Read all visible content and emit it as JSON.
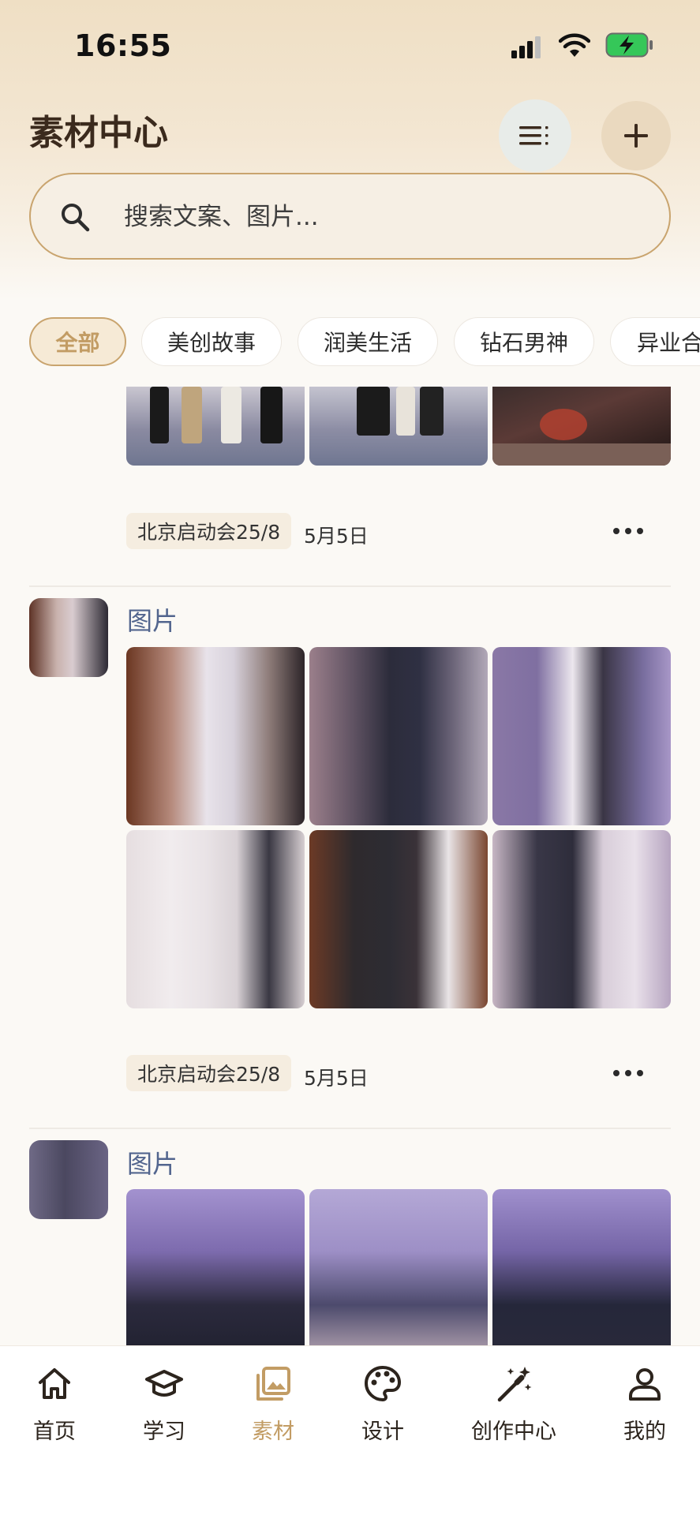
{
  "status_bar": {
    "time": "16:55"
  },
  "header": {
    "title": "素材中心",
    "search_placeholder": "搜索文案、图片..."
  },
  "chips": [
    {
      "label": "全部",
      "active": true
    },
    {
      "label": "美创故事",
      "active": false
    },
    {
      "label": "润美生活",
      "active": false
    },
    {
      "label": "钻石男神",
      "active": false
    },
    {
      "label": "异业合",
      "active": false
    }
  ],
  "posts": [
    {
      "tag": "北京启动会25/8",
      "date": "5月5日"
    },
    {
      "label": "图片",
      "tag": "北京启动会25/8",
      "date": "5月5日"
    },
    {
      "label": "图片"
    }
  ],
  "bottom_nav": [
    {
      "label": "首页",
      "icon": "home-icon"
    },
    {
      "label": "学习",
      "icon": "graduation-cap-icon"
    },
    {
      "label": "素材",
      "icon": "image-gallery-icon",
      "active": true
    },
    {
      "label": "设计",
      "icon": "palette-icon"
    },
    {
      "label": "创作中心",
      "icon": "magic-wand-icon"
    },
    {
      "label": "我的",
      "icon": "user-icon"
    }
  ],
  "colors": {
    "accent": "#c29c64",
    "accent_border": "#c9a46e",
    "post_label": "#52658e",
    "battery_green": "#35c759"
  }
}
